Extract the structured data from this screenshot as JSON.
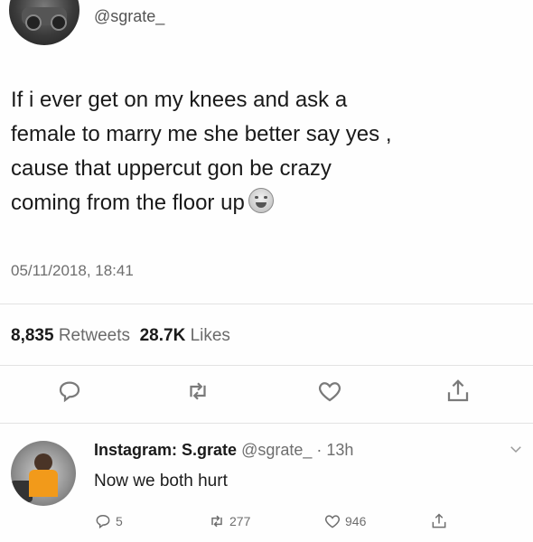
{
  "tweet": {
    "handle": "@sgrate_",
    "lines": [
      "If i ever get on my knees and ask a",
      "female to marry me she better say yes ,",
      "cause that uppercut gon be crazy",
      "coming from the floor up"
    ],
    "emoji": "crying-laughing-face",
    "timestamp": "05/11/2018, 18:41",
    "retweets_count": "8,835",
    "retweets_label": "Retweets",
    "likes_count": "28.7K",
    "likes_label": "Likes"
  },
  "reply": {
    "name": "Instagram: S.grate",
    "meta": "@sgrate_ · 13h",
    "text": "Now we both hurt",
    "reply_count": "5",
    "retweet_count": "277",
    "like_count": "946"
  },
  "icons": [
    "reply-icon",
    "retweet-icon",
    "like-icon",
    "share-icon",
    "chevron-down-icon"
  ],
  "colors": {
    "icon_gray": "#7a7a7a",
    "text_gray": "#6e6e6e"
  }
}
